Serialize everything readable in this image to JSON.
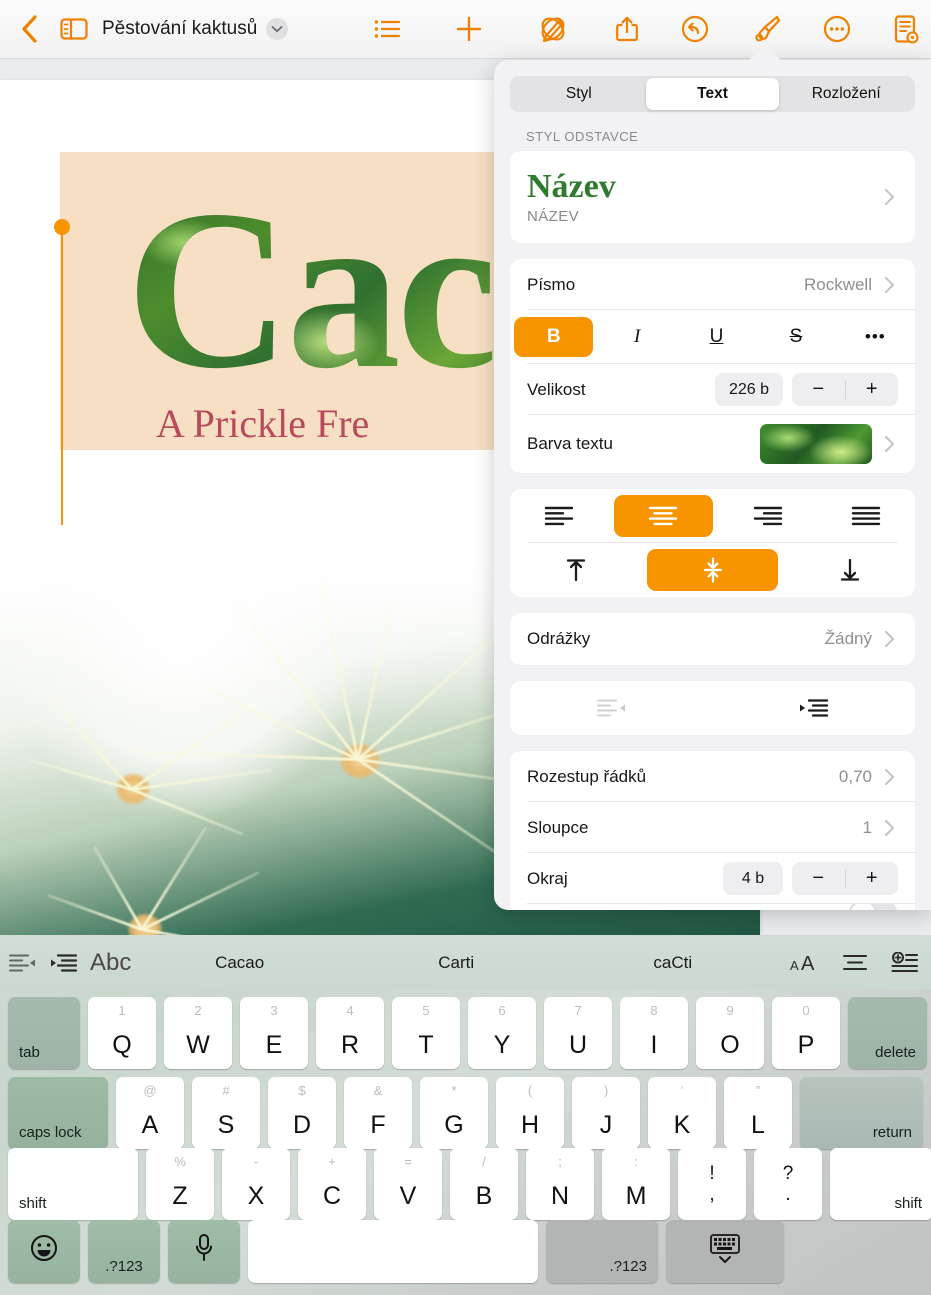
{
  "toolbar": {
    "back_label": "Back",
    "sidebar_label": "Document sidebar",
    "doc_title": "Pěstování kaktusů",
    "icons": [
      "list-icon",
      "plus-icon",
      "collaborate-icon",
      "share-icon",
      "undo-icon",
      "format-brush-icon",
      "more-icon",
      "document-options-icon"
    ]
  },
  "document": {
    "hero_word": "Caca",
    "hero_subtitle": "A Prickle Fre"
  },
  "popover": {
    "tabs": [
      {
        "label": "Styl",
        "active": false
      },
      {
        "label": "Text",
        "active": true
      },
      {
        "label": "Rozložení",
        "active": false
      }
    ],
    "paragraph_section_header": "STYL ODSTAVCE",
    "paragraph_style": {
      "preview": "Název",
      "name": "NÁZEV"
    },
    "font": {
      "label": "Písmo",
      "value": "Rockwell"
    },
    "typeface_buttons": [
      {
        "name": "bold",
        "glyph": "B",
        "active": true
      },
      {
        "name": "italic",
        "glyph": "I",
        "active": false
      },
      {
        "name": "underline",
        "glyph": "U",
        "active": false
      },
      {
        "name": "strikethrough",
        "glyph": "S",
        "active": false
      },
      {
        "name": "more",
        "glyph": "•••",
        "active": false
      }
    ],
    "size": {
      "label": "Velikost",
      "value": "226 b",
      "minus": "−",
      "plus": "+"
    },
    "text_color": {
      "label": "Barva textu"
    },
    "alignment": {
      "horizontal": [
        {
          "name": "align-left",
          "active": false
        },
        {
          "name": "align-center",
          "active": true
        },
        {
          "name": "align-right",
          "active": false
        },
        {
          "name": "align-justify",
          "active": false
        }
      ],
      "vertical": [
        {
          "name": "align-top",
          "active": false
        },
        {
          "name": "align-middle",
          "active": true
        },
        {
          "name": "align-bottom",
          "active": false
        }
      ]
    },
    "bullets": {
      "label": "Odrážky",
      "value": "Žádný"
    },
    "indent": [
      {
        "name": "decrease-indent"
      },
      {
        "name": "increase-indent"
      }
    ],
    "line_spacing": {
      "label": "Rozestup řádků",
      "value": "0,70"
    },
    "columns": {
      "label": "Sloupce",
      "value": "1"
    },
    "margin": {
      "label": "Okraj",
      "value": "4 b",
      "minus": "−",
      "plus": "+"
    },
    "truncated_row": {
      "label": "",
      "toggle_on": false
    }
  },
  "keyboard": {
    "accessory": {
      "left_icons": [
        "outdent-icon",
        "indent-icon"
      ],
      "abc_label": "Abc",
      "suggestions": [
        "Cacao",
        "Carti",
        "caCti"
      ],
      "right_icons": [
        "text-size-icon",
        "paragraph-align-icon",
        "insert-icon"
      ]
    },
    "rows": [
      {
        "name": "row-qwerty",
        "keys": [
          {
            "label": "tab",
            "type": "mod-dark",
            "align": "left"
          },
          {
            "label": "Q",
            "alt": "1"
          },
          {
            "label": "W",
            "alt": "2"
          },
          {
            "label": "E",
            "alt": "3"
          },
          {
            "label": "R",
            "alt": "4"
          },
          {
            "label": "T",
            "alt": "5"
          },
          {
            "label": "Y",
            "alt": "6"
          },
          {
            "label": "U",
            "alt": "7"
          },
          {
            "label": "I",
            "alt": "8"
          },
          {
            "label": "O",
            "alt": "9"
          },
          {
            "label": "P",
            "alt": "0"
          },
          {
            "label": "delete",
            "type": "mod-dark",
            "align": "right"
          }
        ]
      },
      {
        "name": "row-asdf",
        "keys": [
          {
            "label": "caps lock",
            "type": "mod-green",
            "align": "left"
          },
          {
            "label": "A",
            "alt": "@"
          },
          {
            "label": "S",
            "alt": "#"
          },
          {
            "label": "D",
            "alt": "$"
          },
          {
            "label": "F",
            "alt": "&"
          },
          {
            "label": "G",
            "alt": "*"
          },
          {
            "label": "H",
            "alt": "("
          },
          {
            "label": "J",
            "alt": ")"
          },
          {
            "label": "K",
            "alt": "’"
          },
          {
            "label": "L",
            "alt": "”"
          },
          {
            "label": "return",
            "type": "mod-dark2",
            "align": "right"
          }
        ]
      },
      {
        "name": "row-zxcv",
        "keys": [
          {
            "label": "shift",
            "type": "mod-white",
            "align": "left"
          },
          {
            "label": "Z",
            "alt": "%"
          },
          {
            "label": "X",
            "alt": "-"
          },
          {
            "label": "C",
            "alt": "+"
          },
          {
            "label": "V",
            "alt": "="
          },
          {
            "label": "B",
            "alt": "/"
          },
          {
            "label": "N",
            "alt": ";"
          },
          {
            "label": "M",
            "alt": ":"
          },
          {
            "label": ",",
            "alt_top": "!",
            "type": "punct"
          },
          {
            "label": ".",
            "alt_top": "?",
            "type": "punct"
          },
          {
            "label": "shift",
            "type": "mod-white",
            "align": "right"
          }
        ]
      },
      {
        "name": "row-bottom",
        "keys": [
          {
            "label": "emoji-icon",
            "type": "icon-green"
          },
          {
            "label": ".?123",
            "type": "mod-green-ctr"
          },
          {
            "label": "microphone-icon",
            "type": "icon-green"
          },
          {
            "label": "",
            "type": "space"
          },
          {
            "label": ".?123",
            "type": "mod-gray",
            "align": "right"
          },
          {
            "label": "hide-keyboard-icon",
            "type": "icon-gray"
          }
        ]
      }
    ]
  },
  "colors": {
    "accent_orange": "#f79400",
    "toolbar_orange": "#f08000",
    "paragraph_green": "#2f7a2f",
    "subtitle_red": "#b94a5c",
    "hero_bg": "#f7dfc4"
  }
}
